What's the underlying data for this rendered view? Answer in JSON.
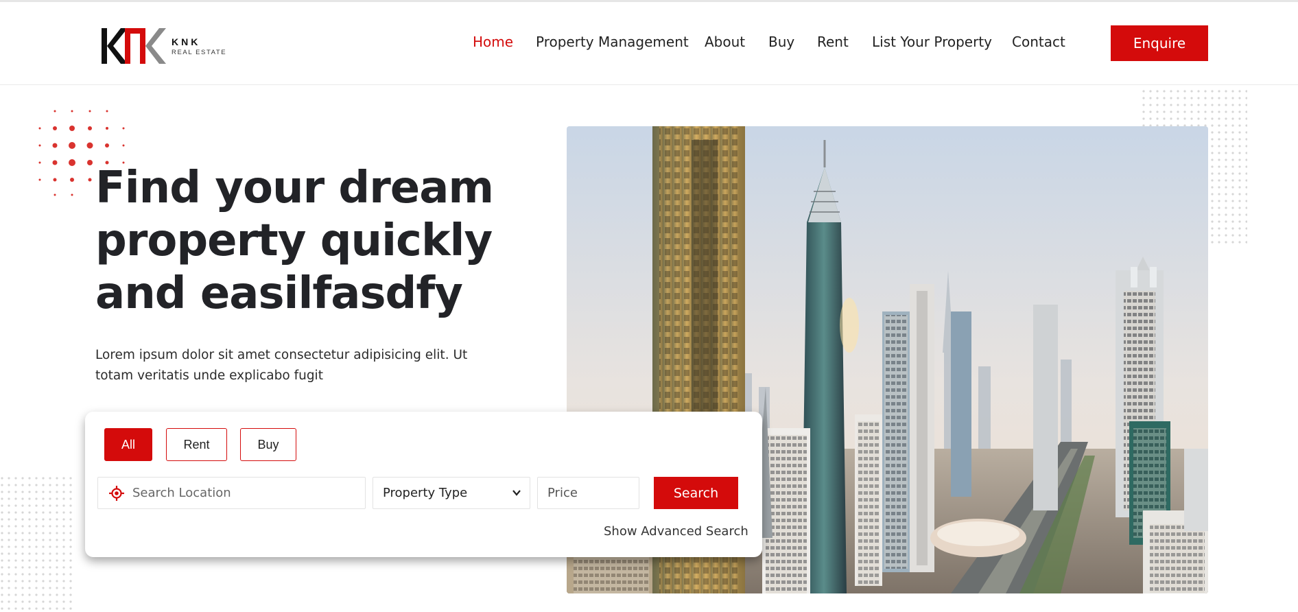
{
  "header": {
    "logo": {
      "brand": "KNK",
      "subtitle": "REAL ESTATE",
      "mark_letters": "KNK",
      "colors": {
        "k": "#111111",
        "n": "#d40b0b",
        "k2": "#888888"
      }
    },
    "nav": [
      {
        "label": "Home",
        "active": true
      },
      {
        "label": "Property Management",
        "active": false
      },
      {
        "label": "About",
        "active": false
      },
      {
        "label": "Buy",
        "active": false
      },
      {
        "label": "Rent",
        "active": false
      },
      {
        "label": "List Your Property",
        "active": false
      },
      {
        "label": "Contact",
        "active": false
      }
    ],
    "enquire_label": "Enquire"
  },
  "hero": {
    "title_lines": [
      "Find your dream",
      "property quickly",
      "and easilfasdfy"
    ],
    "description_lines": [
      "Lorem ipsum dolor sit amet consectetur adipisicing elit. Ut",
      "totam veritatis unde explicabo fugit"
    ],
    "image_subject": "Dubai city skyline with skyscrapers and highway"
  },
  "search": {
    "tabs": [
      {
        "label": "All",
        "active": true
      },
      {
        "label": "Rent",
        "active": false
      },
      {
        "label": "Buy",
        "active": false
      }
    ],
    "location_placeholder": "Search Location",
    "property_type_selected": "Property Type",
    "price_placeholder": "Price",
    "search_label": "Search",
    "advanced_label": "Show Advanced Search"
  },
  "colors": {
    "accent": "#d40b0b",
    "text_dark": "#222327"
  },
  "icons": {
    "location": "crosshair-pin-icon",
    "dropdown": "chevron-down-icon"
  }
}
